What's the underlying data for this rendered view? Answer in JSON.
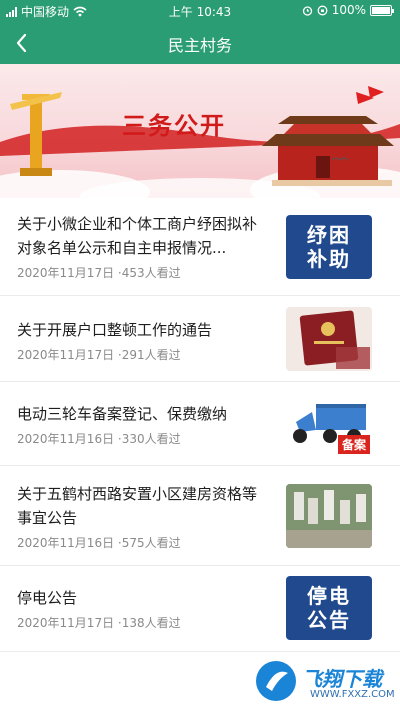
{
  "status_bar": {
    "carrier": "中国移动",
    "time": "上午 10:43",
    "battery": "100%",
    "battery_level": 1.0
  },
  "nav": {
    "title": "民主村务",
    "back_icon": "chevron-left-icon"
  },
  "banner": {
    "title": "三务公开"
  },
  "articles": [
    {
      "title": "关于小微企业和个体工商户纾困拟补对象名单公示和自主申报情况...",
      "date": "2020年11月17日",
      "views": "·453人看过",
      "thumb_line1": "纾困",
      "thumb_line2": "补助"
    },
    {
      "title": "关于开展户口整顿工作的通告",
      "date": "2020年11月17日",
      "views": "·291人看过",
      "thumb": "household-register-photo"
    },
    {
      "title": "电动三轮车备案登记、保费缴纳",
      "date": "2020年11月16日",
      "views": "·330人看过",
      "thumb_badge": "备案"
    },
    {
      "title": "关于五鹤村西路安置小区建房资格等事宜公告",
      "date": "2020年11月16日",
      "views": "·575人看过",
      "thumb": "residential-aerial-photo"
    },
    {
      "title": "停电公告",
      "date": "2020年11月17日",
      "views": "·138人看过",
      "thumb_line1": "停电",
      "thumb_line2": "公告"
    }
  ],
  "watermark": {
    "text": "飞翔下载",
    "sub": "WWW.FXXZ.COM"
  },
  "colors": {
    "brand_green": "#2a9d74",
    "banner_red": "#d11a1a",
    "thumb_blue": "#214a8e",
    "muted_text": "#8a8a8a"
  }
}
